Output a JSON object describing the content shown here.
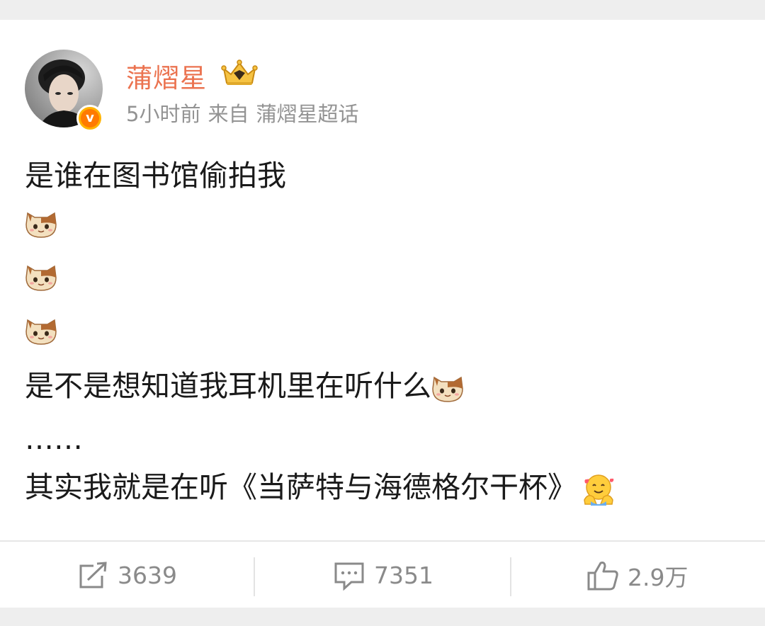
{
  "user": {
    "name": "蒲熠星",
    "time": "5小时前",
    "source_prefix": "来自",
    "source": "蒲熠星超话"
  },
  "post": {
    "line1": "是谁在图书馆偷拍我",
    "line5": "是不是想知道我耳机里在听什么",
    "line6": "……",
    "line7": "其实我就是在听《当萨特与海德格尔干杯》"
  },
  "actions": {
    "repost_count": "3639",
    "comment_count": "7351",
    "like_count": "2.9万"
  },
  "icons": [
    "cat-emoji-icon",
    "hug-emoji-icon",
    "crown-icon",
    "verified-badge-icon",
    "repost-icon",
    "comment-icon",
    "like-icon"
  ],
  "colors": {
    "username": "#eb7350",
    "meta": "#939393",
    "text": "#1a1a1a",
    "action": "#8a8a8a"
  }
}
